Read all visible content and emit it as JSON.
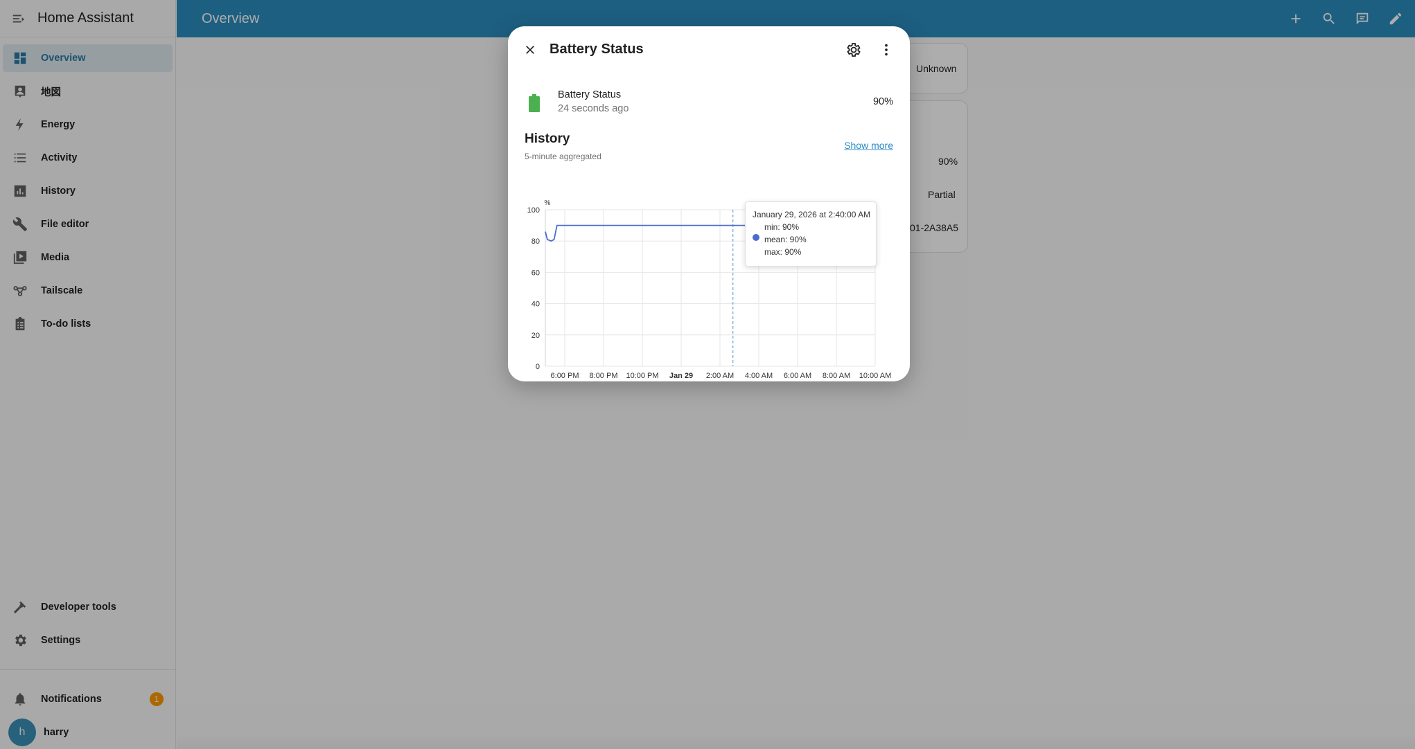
{
  "app": {
    "title": "Home Assistant"
  },
  "sidebar": {
    "items": [
      {
        "label": "Overview",
        "icon": "dashboard-icon"
      },
      {
        "label": "地図",
        "icon": "map-icon"
      },
      {
        "label": "Energy",
        "icon": "lightning-icon"
      },
      {
        "label": "Activity",
        "icon": "list-icon"
      },
      {
        "label": "History",
        "icon": "chart-bar-icon"
      },
      {
        "label": "File editor",
        "icon": "wrench-icon"
      },
      {
        "label": "Media",
        "icon": "media-play-icon"
      },
      {
        "label": "Tailscale",
        "icon": "tailscale-icon"
      },
      {
        "label": "To-do lists",
        "icon": "clipboard-list-icon"
      }
    ],
    "developer_tools": "Developer tools",
    "settings": "Settings",
    "notifications": "Notifications",
    "notifications_count": "1",
    "user": {
      "name": "harry",
      "initial": "h"
    }
  },
  "topbar": {
    "title": "Overview"
  },
  "background": {
    "values": [
      "Unknown",
      "90%",
      "Partial",
      "01-2A38A5"
    ]
  },
  "dialog": {
    "title": "Battery Status",
    "entity": {
      "name": "Battery Status",
      "last_changed": "24 seconds ago",
      "state": "90%"
    },
    "history": {
      "title": "History",
      "subtitle": "5-minute aggregated",
      "show_more": "Show more"
    },
    "tooltip": {
      "date": "January 29, 2026 at 2:40:00 AM",
      "min": "min: 90%",
      "mean": "mean: 90%",
      "max": "max: 90%"
    }
  },
  "colors": {
    "header": "#2b8cbf",
    "accent": "#03a9f4",
    "battery": "#4caf50",
    "line": "#4a6ccf",
    "badge": "#ff9800"
  },
  "chart_data": {
    "type": "line",
    "unit": "%",
    "y_ticks": [
      "100",
      "80",
      "60",
      "40",
      "20",
      "0"
    ],
    "x_ticks": [
      "6:00 PM",
      "8:00 PM",
      "10:00 PM",
      "Jan 29",
      "2:00 AM",
      "4:00 AM",
      "6:00 AM",
      "8:00 AM",
      "10:00 AM"
    ],
    "ylim": [
      0,
      100
    ],
    "series": [
      {
        "points": [
          [
            17.0,
            86
          ],
          [
            17.1,
            81
          ],
          [
            17.3,
            80
          ],
          [
            17.45,
            81
          ],
          [
            17.6,
            90
          ],
          [
            28.0,
            90
          ],
          [
            34.0,
            90
          ]
        ]
      }
    ],
    "x_domain_hours": [
      17.0,
      34.0
    ],
    "hover_x_hours": 26.67
  }
}
